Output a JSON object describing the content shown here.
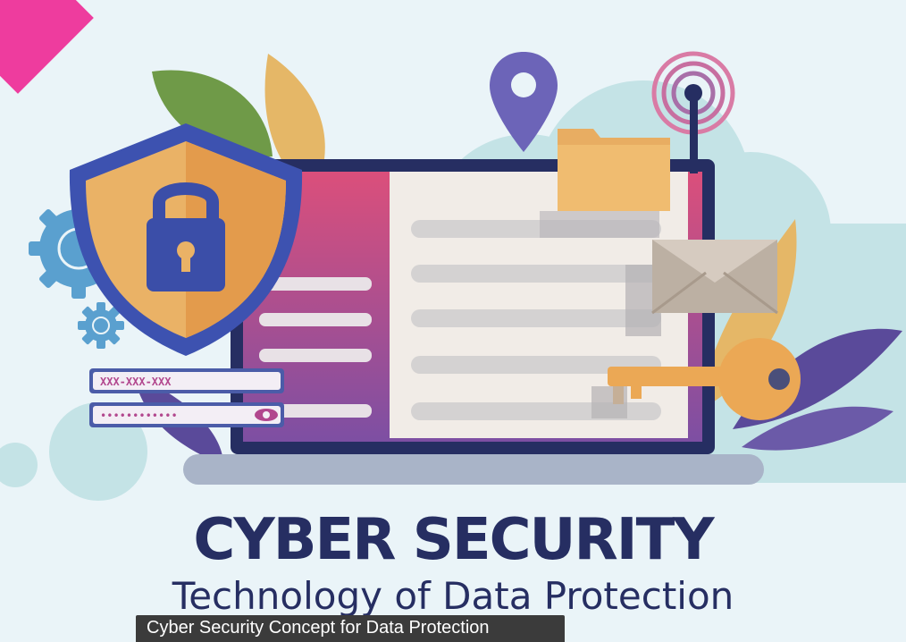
{
  "illustration": {
    "title": "CYBER SECURITY",
    "subtitle": "Technology of Data Protection",
    "username_field_text": "XXX-XXX-XXX",
    "password_field_text": "••••••••••••",
    "caption": "Cyber Security Concept for Data Protection",
    "icons": [
      "shield-lock-icon",
      "gear-icon",
      "location-pin-icon",
      "signal-antenna-icon",
      "folder-icon",
      "envelope-icon",
      "key-icon",
      "eye-icon",
      "leaf-icon"
    ],
    "colors": {
      "background": "#eaf4f8",
      "navy": "#262e62",
      "shield_gold": "#eab266",
      "screen_pink": "#d9507e",
      "screen_purple": "#8957a8",
      "accent_pink": "#ee3c9e"
    }
  }
}
